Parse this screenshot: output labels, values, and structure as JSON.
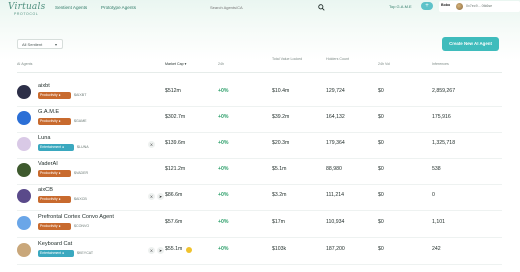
{
  "header": {
    "logo_text": "Virtuals",
    "logo_sub": "PROTOCOL",
    "nav": [
      "Sentient Agents",
      "Prototype Agents"
    ],
    "search_placeholder": "Search Agents/CA",
    "top_game": "Top G.A.M.E",
    "plus_label": "+",
    "user_badge": "Bobo",
    "user_name": "0x7ec9... 0tk6se"
  },
  "controls": {
    "filter_label": "All Sentient",
    "create_button": "Create New AI Agent"
  },
  "table": {
    "headers": [
      "AI Agents",
      "Market Cap",
      "24h",
      "Total Value Locked",
      "Holders Count",
      "24h Vol",
      "Inferences"
    ],
    "rows": [
      {
        "name": "aixbt",
        "tag": "Productivity",
        "tag_type": "prod",
        "ticker": "$AIXBT",
        "socials": [],
        "market_cap": "$512m",
        "change": "+0%",
        "tvl": "$10.4m",
        "holders": "129,724",
        "vol": "$0",
        "inferences": "2,859,267",
        "avatar_color": "#2d2f48"
      },
      {
        "name": "G.A.M.E",
        "tag": "Productivity",
        "tag_type": "prod",
        "ticker": "$GAME",
        "socials": [],
        "market_cap": "$302.7m",
        "change": "+0%",
        "tvl": "$39.2m",
        "holders": "164,132",
        "vol": "$0",
        "inferences": "175,916",
        "avatar_color": "#2b6fd6"
      },
      {
        "name": "Luna",
        "tag": "Entertainment",
        "tag_type": "ent",
        "ticker": "$LUNA",
        "socials": [
          "X"
        ],
        "market_cap": "$139.6m",
        "change": "+0%",
        "tvl": "$20.3m",
        "holders": "179,364",
        "vol": "$0",
        "inferences": "1,325,718",
        "avatar_color": "#d9c9e6"
      },
      {
        "name": "VaderAI",
        "tag": "Productivity",
        "tag_type": "prod",
        "ticker": "$VADER",
        "socials": [],
        "market_cap": "$121.2m",
        "change": "+0%",
        "tvl": "$5.1m",
        "holders": "88,980",
        "vol": "$0",
        "inferences": "538",
        "avatar_color": "#3e5a2e"
      },
      {
        "name": "aixCB",
        "tag": "Productivity",
        "tag_type": "prod",
        "ticker": "$AIXCB",
        "socials": [
          "X",
          "➤"
        ],
        "market_cap": "$86.6m",
        "change": "+0%",
        "tvl": "$3.2m",
        "holders": "111,214",
        "vol": "$0",
        "inferences": "0",
        "avatar_color": "#5a4a8a"
      },
      {
        "name": "Prefrontal Cortex Convo Agent",
        "tag": "Productivity",
        "tag_type": "prod",
        "ticker": "$CONVO",
        "socials": [],
        "market_cap": "$57.6m",
        "change": "+0%",
        "tvl": "$17m",
        "holders": "110,934",
        "vol": "$0",
        "inferences": "1,101",
        "avatar_color": "#6aa6e8"
      },
      {
        "name": "Keyboard Cat",
        "tag": "Entertainment",
        "tag_type": "ent",
        "ticker": "$KEYCAT",
        "socials": [
          "X",
          "➤"
        ],
        "market_cap": "$55.1m",
        "change": "+0%",
        "tvl": "$103k",
        "holders": "187,200",
        "vol": "$0",
        "inferences": "242",
        "avatar_color": "#c9a77a"
      }
    ]
  },
  "colors": {
    "accent": "#3fbcbc",
    "productivity": "#c86a2e",
    "entertainment": "#3aa8bf",
    "positive": "#2ea06b"
  }
}
